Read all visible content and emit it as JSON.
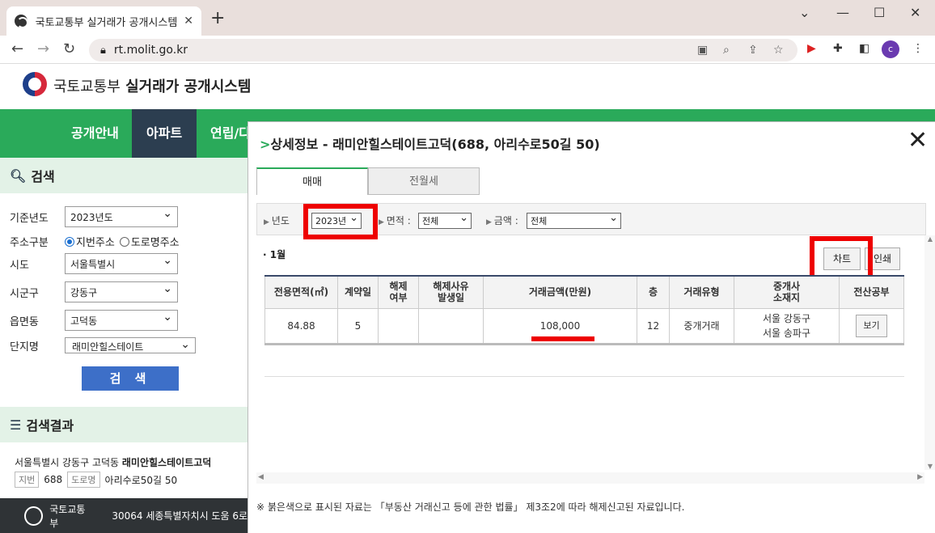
{
  "browser": {
    "tab_title": "국토교통부 실거래가 공개시스템",
    "tab_close": "✕",
    "new_tab": "+",
    "window_controls": [
      "⌄",
      "—",
      "☐",
      "✕"
    ],
    "nav": {
      "back": "←",
      "forward": "→",
      "reload": "↻"
    },
    "url": "rt.molit.go.kr",
    "profile_initial": "c"
  },
  "site": {
    "logo_title_light": "국토교통부",
    "logo_title_bold": "실거래가 공개시스템"
  },
  "gnb": {
    "items": [
      "공개안내",
      "아파트",
      "연립/다"
    ]
  },
  "sidebar": {
    "search_title": "검색",
    "fields": {
      "year_label": "기준년도",
      "year_value": "2023년도",
      "addr_type_label": "주소구분",
      "addr_opt1": "지번주소",
      "addr_opt2": "도로명주소",
      "sido_label": "시도",
      "sido_value": "서울특별시",
      "sigungu_label": "시군구",
      "sigungu_value": "강동구",
      "dong_label": "읍면동",
      "dong_value": "고덕동",
      "complex_label": "단지명",
      "complex_value": "래미안힐스테이트"
    },
    "search_button": "검 색",
    "results_title": "검색결과",
    "result": {
      "addr_prefix": "서울특별시 강동구 고덕동 ",
      "name": "래미안힐스테이트고덕",
      "jibun_tag": "지번",
      "jibun": "688",
      "road_tag": "도로명",
      "road": "아리수로50길 50"
    }
  },
  "footer": {
    "org": "국토교통부",
    "address": "30064 세종특별자치시 도움 6로"
  },
  "modal": {
    "title_prefix": ">",
    "title": "상세정보 - 래미안힐스테이트고덕(688, 아리수로50길 50)",
    "close": "✕",
    "tabs": [
      "매매",
      "전월세"
    ],
    "filters": {
      "year_label": "년도",
      "year_value": "2023년",
      "area_label": "면적 :",
      "area_value": "전체",
      "price_label": "금액 :",
      "price_value": "전체"
    },
    "month": "· 1월",
    "chart_button": "차트",
    "print_button": "인쇄",
    "table": {
      "headers": [
        "전용면적(㎡)",
        "계약일",
        "해제\n여부",
        "해제사유\n발생일",
        "거래금액(만원)",
        "층",
        "거래유형",
        "중개사\n소재지",
        "전산공부"
      ],
      "row": {
        "area": "84.88",
        "day": "5",
        "cancel": "",
        "cancel_date": "",
        "price": "108,000",
        "floor": "12",
        "type": "중개거래",
        "agent_loc1": "서울 강동구",
        "agent_loc2": "서울 송파구",
        "view_button": "보기"
      }
    },
    "note": "※ 붉은색으로 표시된 자료는 「부동산 거래신고 등에 관한 법률」 제3조2에 따라 해제신고된 자료입니다."
  },
  "colors": {
    "green": "#2aaa5a",
    "navy": "#2c3e50",
    "highlight_red": "#ee0000",
    "button_blue": "#3d6fc8"
  }
}
